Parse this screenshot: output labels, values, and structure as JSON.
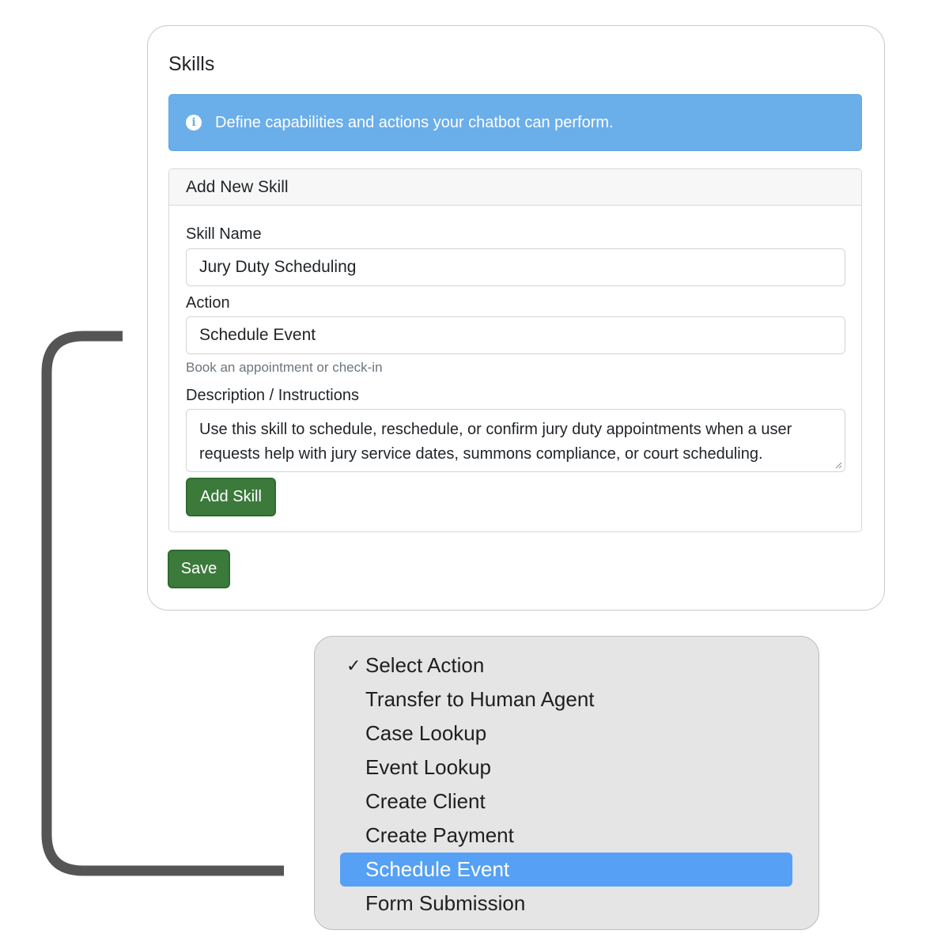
{
  "card": {
    "title": "Skills",
    "alert_text": "Define capabilities and actions your chatbot can perform.",
    "panel": {
      "header": "Add New Skill",
      "skill_name_label": "Skill Name",
      "skill_name_value": "Jury Duty Scheduling",
      "action_label": "Action",
      "action_value": "Schedule Event",
      "action_help": "Book an appointment or check-in",
      "description_label": "Description / Instructions",
      "description_value": "Use this skill to schedule, reschedule, or confirm jury duty appointments when a user requests help with jury service dates, summons compliance, or court scheduling.",
      "add_button": "Add Skill"
    },
    "save_button": "Save"
  },
  "dropdown": {
    "check_glyph": "✓",
    "options": [
      "Select Action",
      "Transfer to Human Agent",
      "Case Lookup",
      "Event Lookup",
      "Create Client",
      "Create Payment",
      "Schedule Event",
      "Form Submission"
    ],
    "checked_option": "Select Action",
    "highlighted_option": "Schedule Event"
  },
  "colors": {
    "alert_bg": "#6aaeea",
    "button_green": "#3c7a3c",
    "highlight_blue": "#56a0f5",
    "connector": "#555555"
  },
  "icons": [
    "info-icon",
    "checkmark-icon",
    "resize-grip-icon"
  ]
}
